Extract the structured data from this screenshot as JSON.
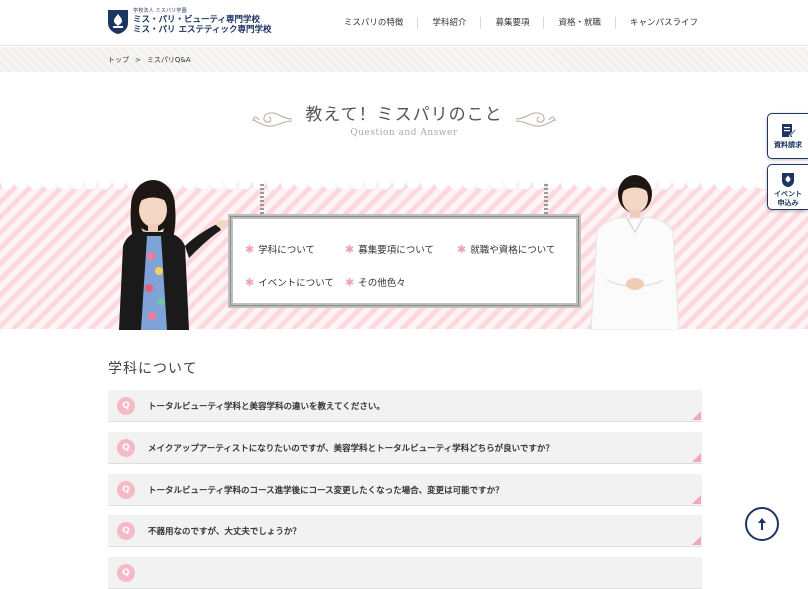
{
  "header": {
    "logo_sub": "学校法人 ミスパリ学園",
    "logo_line1": "ミス・パリ・ビューティ専門学校",
    "logo_line2": "ミス・パリ エステティック専門学校",
    "nav": [
      "ミスパリの特徴",
      "学科紹介",
      "募集要項",
      "資格・就職",
      "キャンパスライフ"
    ]
  },
  "breadcrumb": {
    "home": "トップ",
    "separator": ">",
    "current": "ミスパリQ&A"
  },
  "page": {
    "title": "教えて！ミスパリのこと",
    "subtitle": "Question and Answer"
  },
  "hero": {
    "links": [
      "学科について",
      "募集要項について",
      "就職や資格について",
      "イベントについて",
      "その他色々"
    ]
  },
  "section": {
    "title": "学科について",
    "q_marker": "Q",
    "questions": [
      "トータルビューティ学科と美容学科の違いを教えてください。",
      "メイクアップアーティストになりたいのですが、美容学科とトータルビューティ学科どちらが良いですか？",
      "トータルビューティ学科のコース進学後にコース変更したくなった場合、変更は可能ですか？",
      "不器用なのですが、大丈夫でしょうか？"
    ]
  },
  "side": {
    "request_label": "資料請求",
    "event_label1": "イベント",
    "event_label2": "申込み"
  },
  "colors": {
    "navy": "#1d3561",
    "pink": "#f6b9c6",
    "pink_corner": "#f3a6c0"
  },
  "icons": {
    "page_top": "arrow-up-icon",
    "request": "document-pen-icon",
    "event": "school-crest-icon"
  }
}
